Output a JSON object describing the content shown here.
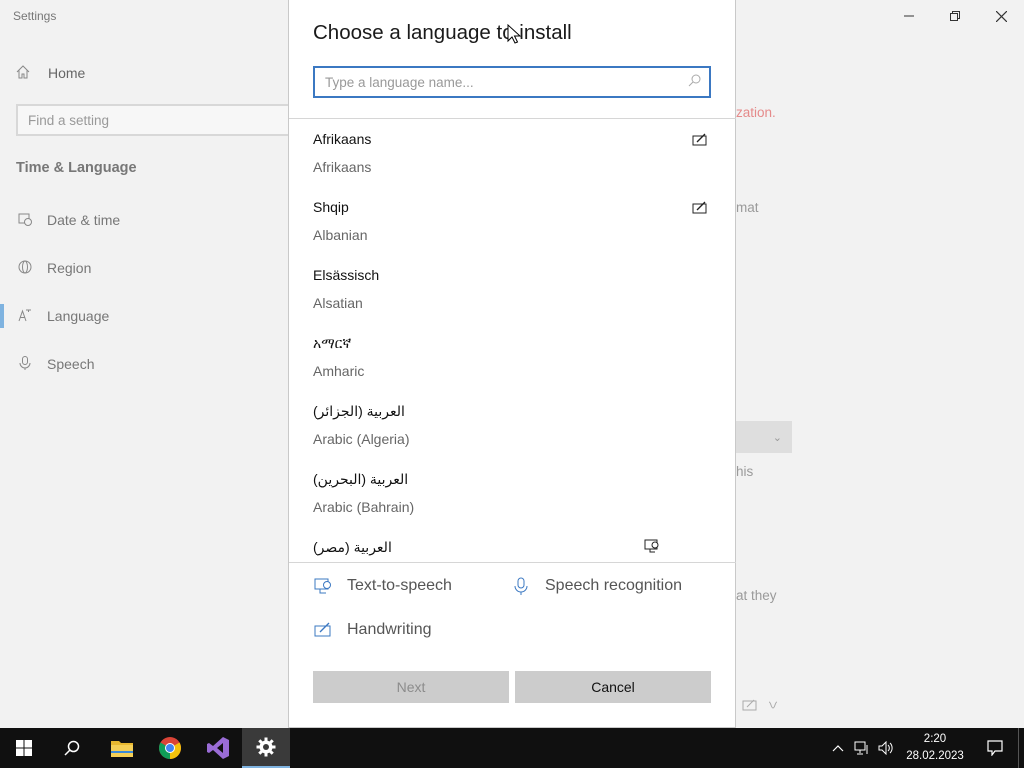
{
  "window": {
    "title": "Settings",
    "minimize_icon": "minimize-icon",
    "restore_icon": "restore-icon",
    "close_icon": "close-icon"
  },
  "nav": {
    "home_label": "Home",
    "search_placeholder": "Find a setting",
    "group_title": "Time & Language",
    "items": [
      {
        "label": "Date & time",
        "icon": "calendar-clock-icon"
      },
      {
        "label": "Region",
        "icon": "globe-icon"
      },
      {
        "label": "Language",
        "icon": "language-icon",
        "active": true
      },
      {
        "label": "Speech",
        "icon": "microphone-icon"
      }
    ]
  },
  "background": {
    "text_red": "zation.",
    "text_format": "mat",
    "text_this": "his",
    "text_they": "at they"
  },
  "dialog": {
    "title": "Choose a language to install",
    "search_placeholder": "Type a language name...",
    "languages": [
      {
        "native": "Afrikaans",
        "english": "Afrikaans",
        "features": [
          "handwriting"
        ]
      },
      {
        "native": "Shqip",
        "english": "Albanian",
        "features": [
          "handwriting"
        ]
      },
      {
        "native": "Elsässisch",
        "english": "Alsatian",
        "features": []
      },
      {
        "native": "አማርኛ",
        "english": "Amharic",
        "features": []
      },
      {
        "native": "العربية (الجزائر)",
        "english": "Arabic (Algeria)",
        "features": []
      },
      {
        "native": "العربية (البحرين)",
        "english": "Arabic (Bahrain)",
        "features": []
      },
      {
        "native": "العربية (مصر)",
        "english": "",
        "features": [
          "text-to-speech"
        ]
      }
    ],
    "legend": {
      "tts": "Text-to-speech",
      "speech": "Speech recognition",
      "handwriting": "Handwriting"
    },
    "buttons": {
      "next": "Next",
      "cancel": "Cancel"
    }
  },
  "taskbar": {
    "apps": [
      "start-icon",
      "search-icon",
      "file-explorer-icon",
      "chrome-icon",
      "visual-studio-icon",
      "settings-icon"
    ],
    "time": "2:20",
    "date": "28.02.2023"
  }
}
